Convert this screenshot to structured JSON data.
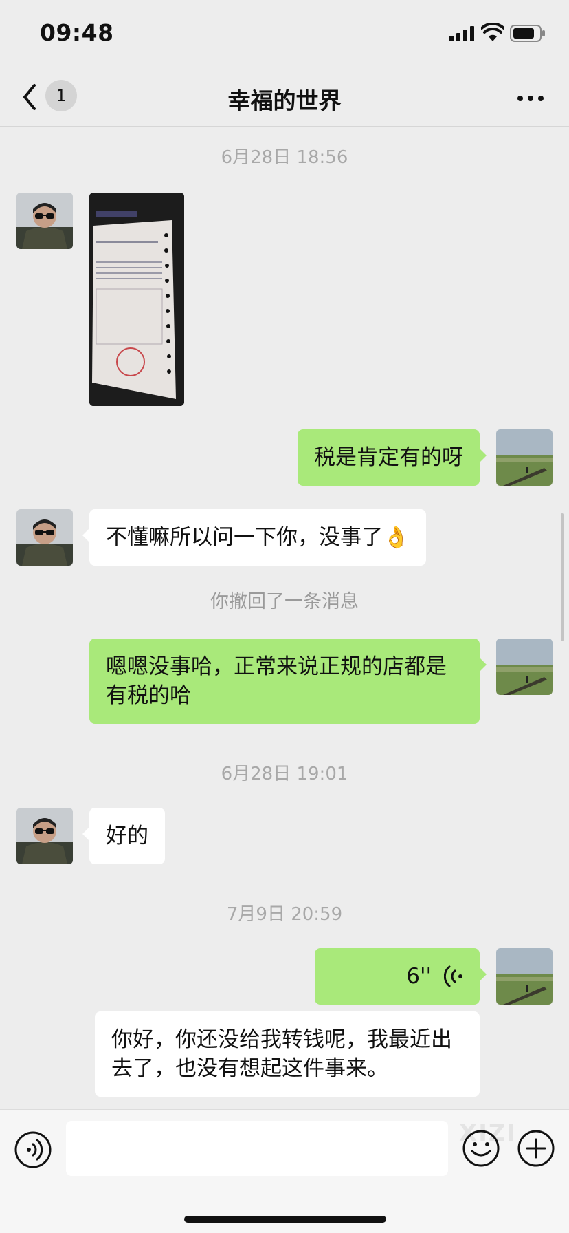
{
  "status_bar": {
    "time": "09:48"
  },
  "header": {
    "unread_count": "1",
    "title": "幸福的世界"
  },
  "messages": {
    "ts1": "6月28日 18:56",
    "m1_text": "税是肯定有的呀",
    "m2_text": "不懂嘛所以问一下你，没事了👌",
    "recall_text": "你撤回了一条消息",
    "m3_text": "嗯嗯没事哈，正常来说正规的店都是有税的哈",
    "ts2": "6月28日 19:01",
    "m4_text": "好的",
    "ts3": "7月9日 20:59",
    "voice_duration": "6''",
    "m5_text": "你好，你还没给我转钱呢，我最近出去了，也没有想起这件事来。"
  },
  "input_bar": {
    "placeholder": "",
    "watermark": "XIZI"
  },
  "colors": {
    "sent_bubble": "#a9e97a",
    "received_bubble": "#ffffff",
    "background": "#ededed"
  },
  "icons": [
    "back-icon",
    "more-icon",
    "voice-input-icon",
    "emoji-icon",
    "plus-icon",
    "voice-wave-icon",
    "signal-icon",
    "wifi-icon",
    "battery-icon"
  ]
}
